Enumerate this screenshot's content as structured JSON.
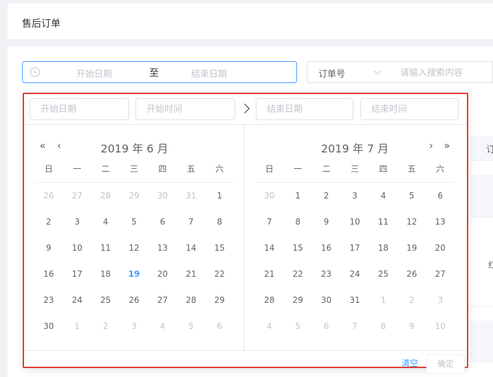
{
  "page": {
    "title": "售后订单"
  },
  "range_input": {
    "start_placeholder": "开始日期",
    "separator": "至",
    "end_placeholder": "结束日期"
  },
  "search": {
    "select_value": "订单号",
    "placeholder": "请输入搜索内容"
  },
  "table_partial": {
    "header_text": "订",
    "row_text": "红"
  },
  "picker": {
    "start_date_placeholder": "开始日期",
    "start_time_placeholder": "开始时间",
    "end_date_placeholder": "结束日期",
    "end_time_placeholder": "结束时间",
    "weekdays": [
      "日",
      "一",
      "二",
      "三",
      "四",
      "五",
      "六"
    ],
    "left": {
      "header": "2019 年 6 月",
      "days": [
        {
          "d": "26",
          "off": true
        },
        {
          "d": "27",
          "off": true
        },
        {
          "d": "28",
          "off": true
        },
        {
          "d": "29",
          "off": true
        },
        {
          "d": "30",
          "off": true
        },
        {
          "d": "31",
          "off": true
        },
        {
          "d": "1"
        },
        {
          "d": "2"
        },
        {
          "d": "3"
        },
        {
          "d": "4"
        },
        {
          "d": "5"
        },
        {
          "d": "6"
        },
        {
          "d": "7"
        },
        {
          "d": "8"
        },
        {
          "d": "9"
        },
        {
          "d": "10"
        },
        {
          "d": "11"
        },
        {
          "d": "12"
        },
        {
          "d": "13"
        },
        {
          "d": "14"
        },
        {
          "d": "15"
        },
        {
          "d": "16"
        },
        {
          "d": "17"
        },
        {
          "d": "18"
        },
        {
          "d": "19",
          "today": true
        },
        {
          "d": "20"
        },
        {
          "d": "21"
        },
        {
          "d": "22"
        },
        {
          "d": "23"
        },
        {
          "d": "24"
        },
        {
          "d": "25"
        },
        {
          "d": "26"
        },
        {
          "d": "27"
        },
        {
          "d": "28"
        },
        {
          "d": "29"
        },
        {
          "d": "30"
        },
        {
          "d": "1",
          "off": true
        },
        {
          "d": "2",
          "off": true
        },
        {
          "d": "3",
          "off": true
        },
        {
          "d": "4",
          "off": true
        },
        {
          "d": "5",
          "off": true
        },
        {
          "d": "6",
          "off": true
        }
      ]
    },
    "right": {
      "header": "2019 年 7 月",
      "days": [
        {
          "d": "30",
          "off": true
        },
        {
          "d": "1"
        },
        {
          "d": "2"
        },
        {
          "d": "3"
        },
        {
          "d": "4"
        },
        {
          "d": "5"
        },
        {
          "d": "6"
        },
        {
          "d": "7"
        },
        {
          "d": "8"
        },
        {
          "d": "9"
        },
        {
          "d": "10"
        },
        {
          "d": "11"
        },
        {
          "d": "12"
        },
        {
          "d": "13"
        },
        {
          "d": "14"
        },
        {
          "d": "15"
        },
        {
          "d": "16"
        },
        {
          "d": "17"
        },
        {
          "d": "18"
        },
        {
          "d": "19"
        },
        {
          "d": "20"
        },
        {
          "d": "21"
        },
        {
          "d": "22"
        },
        {
          "d": "23"
        },
        {
          "d": "24"
        },
        {
          "d": "25"
        },
        {
          "d": "26"
        },
        {
          "d": "27"
        },
        {
          "d": "28"
        },
        {
          "d": "29"
        },
        {
          "d": "30"
        },
        {
          "d": "31"
        },
        {
          "d": "1",
          "off": true
        },
        {
          "d": "2",
          "off": true
        },
        {
          "d": "3",
          "off": true
        },
        {
          "d": "4",
          "off": true
        },
        {
          "d": "5",
          "off": true
        },
        {
          "d": "6",
          "off": true
        },
        {
          "d": "7",
          "off": true
        },
        {
          "d": "8",
          "off": true
        },
        {
          "d": "9",
          "off": true
        },
        {
          "d": "10",
          "off": true
        }
      ]
    },
    "nav": {
      "prev_year": "«",
      "prev_month": "‹",
      "next_month": "›",
      "next_year": "»"
    },
    "footer": {
      "clear_label": "清空",
      "confirm_label": "确定"
    }
  },
  "colors": {
    "accent": "#409eff",
    "highlight_border": "#e23a30",
    "muted": "#c0c4cc"
  }
}
